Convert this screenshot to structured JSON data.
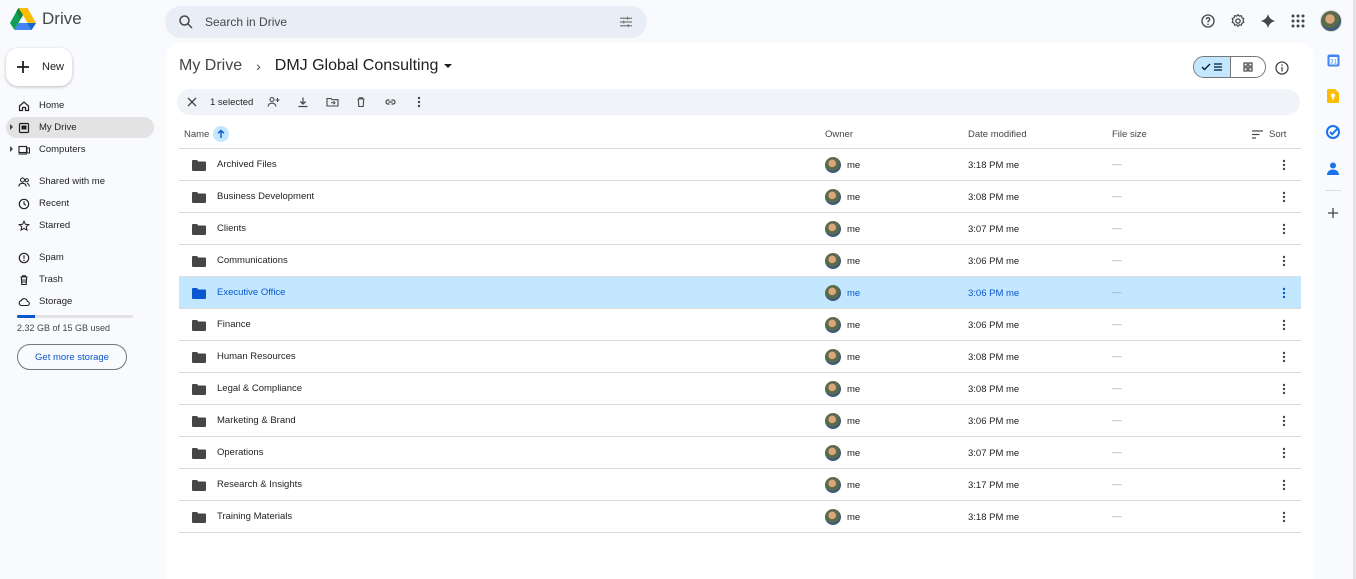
{
  "app": {
    "name": "Drive"
  },
  "search": {
    "placeholder": "Search in Drive"
  },
  "header_icons": [
    "help-icon",
    "settings-icon",
    "gemini-icon",
    "apps-grid-icon",
    "account-avatar"
  ],
  "new_button": {
    "label": "New"
  },
  "sidebar": {
    "items": [
      {
        "label": "Home",
        "icon": "home-icon"
      },
      {
        "label": "My Drive",
        "icon": "my-drive-icon",
        "active": true
      },
      {
        "label": "Computers",
        "icon": "computers-icon"
      },
      {
        "label": "Shared with me",
        "icon": "shared-icon"
      },
      {
        "label": "Recent",
        "icon": "clock-icon"
      },
      {
        "label": "Starred",
        "icon": "star-icon"
      },
      {
        "label": "Spam",
        "icon": "spam-icon"
      },
      {
        "label": "Trash",
        "icon": "trash-icon"
      },
      {
        "label": "Storage",
        "icon": "cloud-icon"
      }
    ]
  },
  "storage": {
    "used_text": "2.32 GB of 15 GB used",
    "used_fraction": 0.155,
    "button_label": "Get more storage"
  },
  "breadcrumb": {
    "root": "My Drive",
    "current": "DMJ Global Consulting"
  },
  "selection": {
    "count_label": "1 selected"
  },
  "table": {
    "columns": {
      "name": "Name",
      "owner": "Owner",
      "date": "Date modified",
      "size": "File size",
      "sort": "Sort"
    },
    "rows": [
      {
        "name": "Archived Files",
        "owner": "me",
        "date": "3:18 PM me",
        "size": "—"
      },
      {
        "name": "Business Development",
        "owner": "me",
        "date": "3:08 PM me",
        "size": "—"
      },
      {
        "name": "Clients",
        "owner": "me",
        "date": "3:07 PM me",
        "size": "—"
      },
      {
        "name": "Communications",
        "owner": "me",
        "date": "3:06 PM me",
        "size": "—"
      },
      {
        "name": "Executive Office",
        "owner": "me",
        "date": "3:06 PM me",
        "size": "—",
        "selected": true
      },
      {
        "name": "Finance",
        "owner": "me",
        "date": "3:06 PM me",
        "size": "—"
      },
      {
        "name": "Human Resources",
        "owner": "me",
        "date": "3:08 PM me",
        "size": "—"
      },
      {
        "name": "Legal & Compliance",
        "owner": "me",
        "date": "3:08 PM me",
        "size": "—"
      },
      {
        "name": "Marketing & Brand",
        "owner": "me",
        "date": "3:06 PM me",
        "size": "—"
      },
      {
        "name": "Operations",
        "owner": "me",
        "date": "3:07 PM me",
        "size": "—"
      },
      {
        "name": "Research & Insights",
        "owner": "me",
        "date": "3:17 PM me",
        "size": "—"
      },
      {
        "name": "Training Materials",
        "owner": "me",
        "date": "3:18 PM me",
        "size": "—"
      }
    ]
  },
  "colors": {
    "accent": "#0b57d0",
    "selected_row": "#c2e7ff",
    "background": "#f8fafd"
  }
}
